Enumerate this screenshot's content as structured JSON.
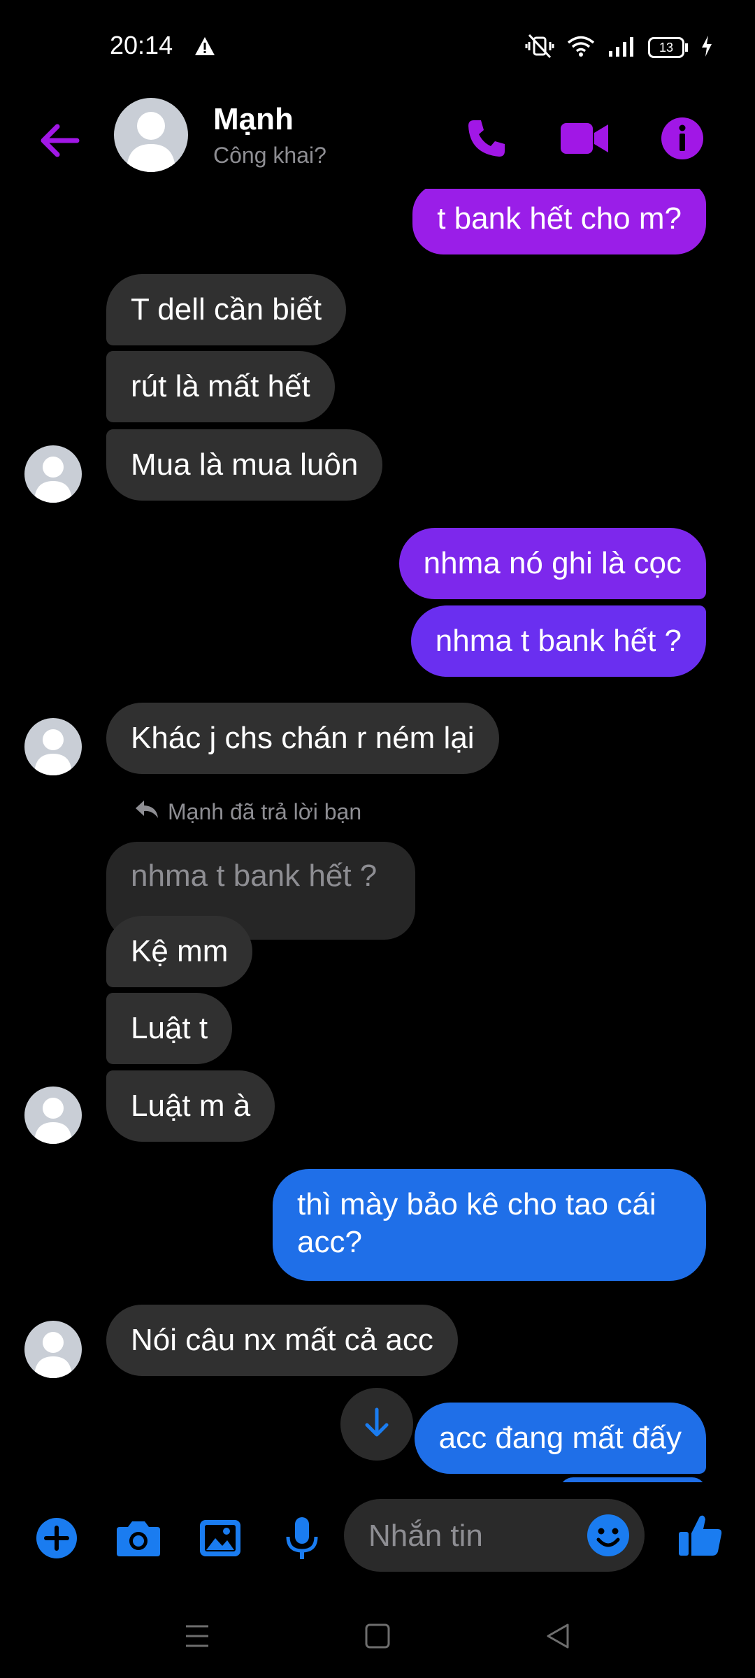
{
  "status_bar": {
    "time": "20:14",
    "battery": "13",
    "icons": [
      "warning-icon",
      "mute-vibrate-icon",
      "wifi-icon",
      "signal-icon",
      "battery-icon",
      "charging-icon"
    ]
  },
  "header": {
    "name": "Mạnh",
    "subtitle": "Công khai?",
    "accent": "#a117e6"
  },
  "messages": [
    {
      "side": "out",
      "text": "t bank hết cho m?"
    },
    {
      "side": "in",
      "text": "T dell cần biết"
    },
    {
      "side": "in",
      "text": "rút là mất hết"
    },
    {
      "side": "in",
      "text": "Mua là mua luôn"
    },
    {
      "side": "out",
      "text": "nhma nó ghi là cọc"
    },
    {
      "side": "out",
      "text": "nhma t bank hết ?"
    },
    {
      "side": "in",
      "text": "Khác j chs chán r ném lại"
    },
    {
      "side": "in",
      "text": "Kệ mm"
    },
    {
      "side": "in",
      "text": "Luật t"
    },
    {
      "side": "in",
      "text": "Luật m à"
    },
    {
      "side": "out",
      "text": "thì mày bảo kê cho tao cái\nacc?"
    },
    {
      "side": "in",
      "text": "Nói câu nx mất cả acc"
    },
    {
      "side": "out",
      "text": "acc đang mất đấy"
    }
  ],
  "reply": {
    "note": "Mạnh đã trả lời bạn",
    "quoted_text": "nhma t bank hết ?"
  },
  "composer": {
    "placeholder": "Nhắn tin"
  },
  "colors": {
    "incoming": "#303030",
    "outgoing_purple": "#9a1ee8",
    "outgoing_blue": "#1f6fe8",
    "icon_blue": "#1a7cf0"
  }
}
